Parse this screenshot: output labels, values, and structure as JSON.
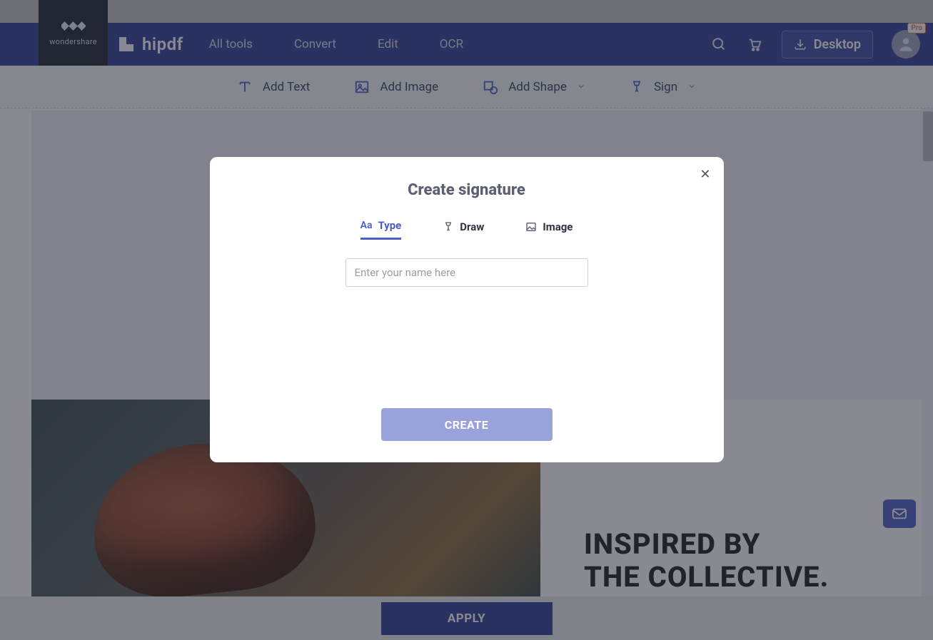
{
  "brand": {
    "company": "wondershare",
    "product": "hipdf"
  },
  "nav": {
    "links": [
      "All tools",
      "Convert",
      "Edit",
      "OCR"
    ],
    "desktop_label": "Desktop",
    "pro_badge": "Pro"
  },
  "toolbar": {
    "add_text": "Add Text",
    "add_image": "Add Image",
    "add_shape": "Add Shape",
    "sign": "Sign"
  },
  "document": {
    "headline_line1": "INSPIRED BY",
    "headline_line2": "THE COLLECTIVE."
  },
  "footer": {
    "apply_label": "APPLY"
  },
  "modal": {
    "title": "Create signature",
    "tabs": {
      "type": "Type",
      "draw": "Draw",
      "image": "Image"
    },
    "input_placeholder": "Enter your name here",
    "create_label": "CREATE"
  }
}
